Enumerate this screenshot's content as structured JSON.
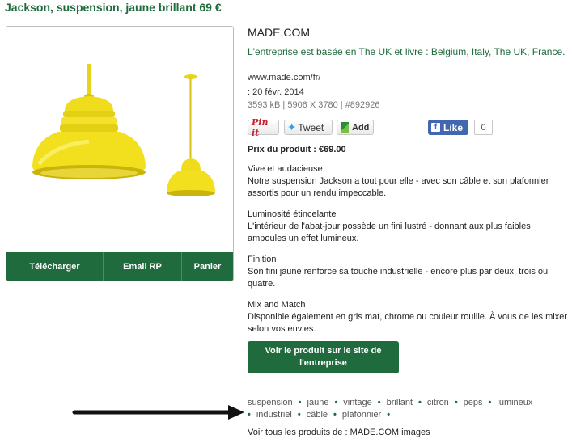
{
  "title": "Jackson, suspension, jaune brillant 69 €",
  "product_card": {
    "actions": [
      "Télécharger",
      "Email RP",
      "Panier"
    ]
  },
  "brand": "MADE.COM",
  "company_line": "L'entreprise est basée en The UK et livre : Belgium, Italy, The UK, France.",
  "url": "www.made.com/fr/",
  "date": ": 20 févr. 2014",
  "meta": "3593 kB | 5906 X 3780 | #892926",
  "share": {
    "pinit": "Pin it",
    "tweet": "Tweet",
    "add": "Add",
    "like": "Like",
    "like_count": "0"
  },
  "price": "Prix du produit : €69.00",
  "description": [
    {
      "heading": "Vive et audacieuse",
      "text": "Notre suspension Jackson a tout pour elle - avec son câble et son plafonnier assortis pour un rendu impeccable."
    },
    {
      "heading": "Luminosité étincelante",
      "text": "L'intérieur de l'abat-jour possède un fini lustré - donnant aux plus faibles ampoules un effet lumineux."
    },
    {
      "heading": "Finition",
      "text": "Son fini jaune renforce sa touche industrielle - encore plus par deux, trois ou quatre."
    },
    {
      "heading": "Mix and Match",
      "text": "Disponible également en gris mat, chrome ou couleur rouille. À vous de les mixer selon vos envies."
    }
  ],
  "cta": "Voir le produit sur le site de l'entreprise",
  "tags": [
    "suspension",
    "jaune",
    "vintage",
    "brillant",
    "citron",
    "peps",
    "lumineux",
    "industriel",
    "câble",
    "plafonnier"
  ],
  "all_products": "Voir tous les produits de : MADE.COM images",
  "colors": {
    "brand_green": "#1f6b3d",
    "lamp_yellow": "#f2e01e",
    "facebook_blue": "#4267b2"
  }
}
